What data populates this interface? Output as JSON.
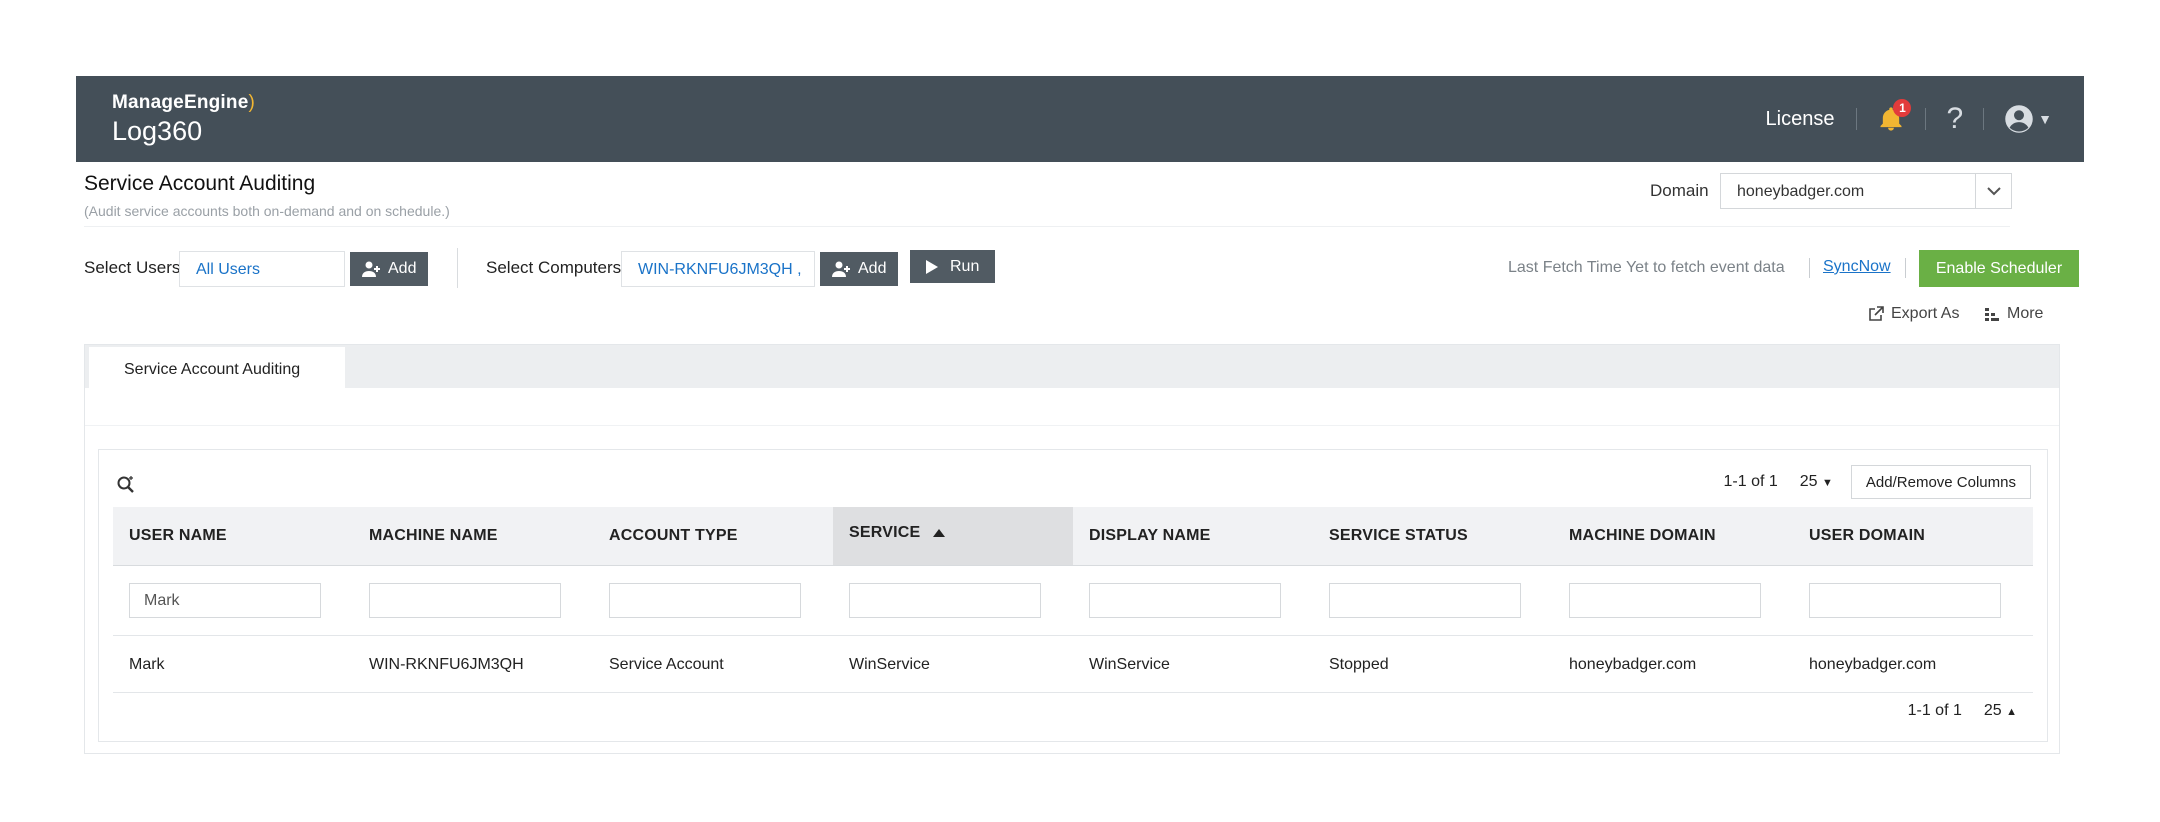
{
  "header": {
    "brand": "ManageEngine",
    "product": "Log360",
    "license_label": "License",
    "notification_count": "1",
    "help_label": "?"
  },
  "page": {
    "title": "Service Account Auditing",
    "subtitle": "(Audit service accounts both on-demand and on schedule.)",
    "domain_label": "Domain",
    "domain_value": "honeybadger.com"
  },
  "toolbar": {
    "select_users_label": "Select Users",
    "users_value": "All Users",
    "add_users_label": "Add",
    "select_computers_label": "Select Computers",
    "computers_value": "WIN-RKNFU6JM3QH ,",
    "add_computers_label": "Add",
    "run_label": "Run",
    "last_fetch_text": "Last Fetch Time Yet to fetch event data",
    "sync_now_label": "SyncNow",
    "enable_scheduler_label": "Enable Scheduler",
    "export_label": "Export As",
    "more_label": "More"
  },
  "tabs": [
    {
      "label": "Service Account Auditing"
    }
  ],
  "table": {
    "pagination_text": "1-1 of 1",
    "per_page": "25",
    "add_remove_label": "Add/Remove Columns",
    "columns": [
      "USER NAME",
      "MACHINE NAME",
      "ACCOUNT TYPE",
      "SERVICE",
      "DISPLAY NAME",
      "SERVICE STATUS",
      "MACHINE DOMAIN",
      "USER DOMAIN"
    ],
    "sorted_column": "SERVICE",
    "filters": [
      "Mark",
      "",
      "",
      "",
      "",
      "",
      "",
      ""
    ],
    "rows": [
      [
        "Mark",
        "WIN-RKNFU6JM3QH",
        "Service Account",
        "WinService",
        "WinService",
        "Stopped",
        "honeybadger.com",
        "honeybadger.com"
      ]
    ],
    "footer_pagination_text": "1-1 of 1",
    "footer_per_page": "25"
  },
  "colors": {
    "header_bg": "#444f58",
    "accent_blue": "#1a73c8",
    "scheduler_green": "#6ab045",
    "badge_red": "#e23b3b"
  },
  "icons": {
    "notification": "bell-icon",
    "help": "question-icon",
    "user": "user-avatar-icon",
    "add": "add-user-icon",
    "run": "play-icon",
    "export": "export-icon",
    "more": "more-icon",
    "search": "search-icon",
    "sort": "sort-ascending-icon"
  }
}
